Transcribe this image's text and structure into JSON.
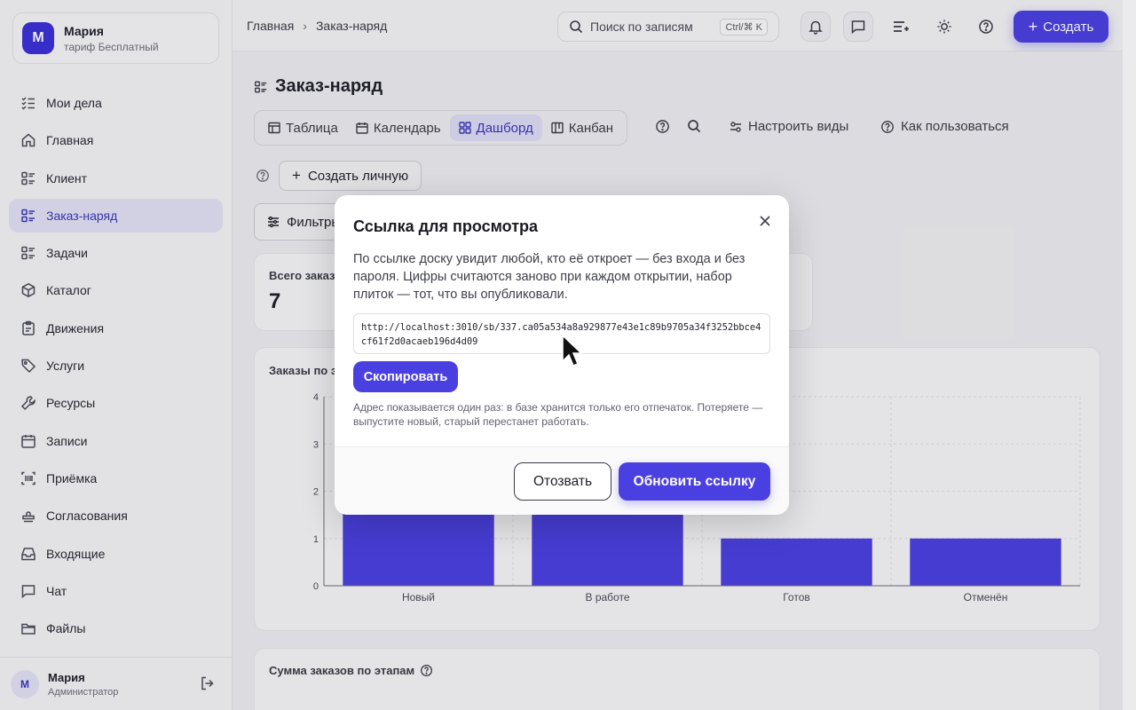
{
  "user": {
    "initial": "М",
    "name": "Мария",
    "plan": "тариф Бесплатный",
    "role": "Администратор"
  },
  "sidebar": {
    "items": [
      {
        "label": "Мои дела",
        "icon": "checklist-icon"
      },
      {
        "label": "Главная",
        "icon": "home-icon"
      },
      {
        "label": "Клиент",
        "icon": "list-icon"
      },
      {
        "label": "Заказ-наряд",
        "icon": "list-icon",
        "active": true
      },
      {
        "label": "Задачи",
        "icon": "list-icon"
      },
      {
        "label": "Каталог",
        "icon": "box-icon"
      },
      {
        "label": "Движения",
        "icon": "clipboard-icon"
      },
      {
        "label": "Услуги",
        "icon": "tag-icon"
      },
      {
        "label": "Ресурсы",
        "icon": "wrench-icon"
      },
      {
        "label": "Записи",
        "icon": "calendar-icon"
      },
      {
        "label": "Приёмка",
        "icon": "barcode-icon"
      },
      {
        "label": "Согласования",
        "icon": "stamp-icon"
      },
      {
        "label": "Входящие",
        "icon": "inbox-icon"
      },
      {
        "label": "Чат",
        "icon": "chat-icon"
      },
      {
        "label": "Файлы",
        "icon": "folder-icon"
      }
    ]
  },
  "header": {
    "breadcrumb": [
      "Главная",
      "Заказ-наряд"
    ],
    "search_placeholder": "Поиск по записям",
    "shortcut": "Ctrl/⌘ K",
    "create_label": "Создать"
  },
  "page": {
    "title": "Заказ-наряд",
    "views": [
      {
        "label": "Таблица",
        "icon": "table-icon"
      },
      {
        "label": "Календарь",
        "icon": "calendar-icon"
      },
      {
        "label": "Дашборд",
        "icon": "grid-icon",
        "active": true
      },
      {
        "label": "Канбан",
        "icon": "kanban-icon"
      }
    ],
    "configure_views": "Настроить виды",
    "how_to_use": "Как пользоваться",
    "create_personal": "Создать личную",
    "filters": "Фильтры",
    "total_orders_label": "Всего заказов",
    "total_orders_value": "7",
    "orders_by_stage_label": "Заказы по этапам",
    "sum_by_stage_label": "Сумма заказов по этапам"
  },
  "chart_data": {
    "type": "bar",
    "title": "Заказы по этапам",
    "categories": [
      "Новый",
      "В работе",
      "Готов",
      "Отменён"
    ],
    "values": [
      3,
      2,
      1,
      1
    ],
    "ylim": [
      0,
      4
    ],
    "yticks": [
      "0",
      "1",
      "2",
      "3",
      "4"
    ],
    "grid": true,
    "color": "#4a3fe0"
  },
  "modal": {
    "title": "Ссылка для просмотра",
    "description": "По ссылке доску увидит любой, кто её откроет — без входа и без пароля. Цифры считаются заново при каждом открытии, набор плиток — тот, что вы опубликовали.",
    "link": "http://localhost:3010/sb/337.ca05a534a8a929877e43e1c89b9705a34f3252bbce4cf61f2d0acaeb196d4d09",
    "copy_label": "Скопировать",
    "note": "Адрес показывается один раз: в базе хранится только его отпечаток. Потеряете — выпустите новый, старый перестанет работать.",
    "revoke_label": "Отозвать",
    "refresh_label": "Обновить ссылку"
  },
  "colors": {
    "accent": "#4a3fe0",
    "active_bg": "#e2e1f5"
  }
}
